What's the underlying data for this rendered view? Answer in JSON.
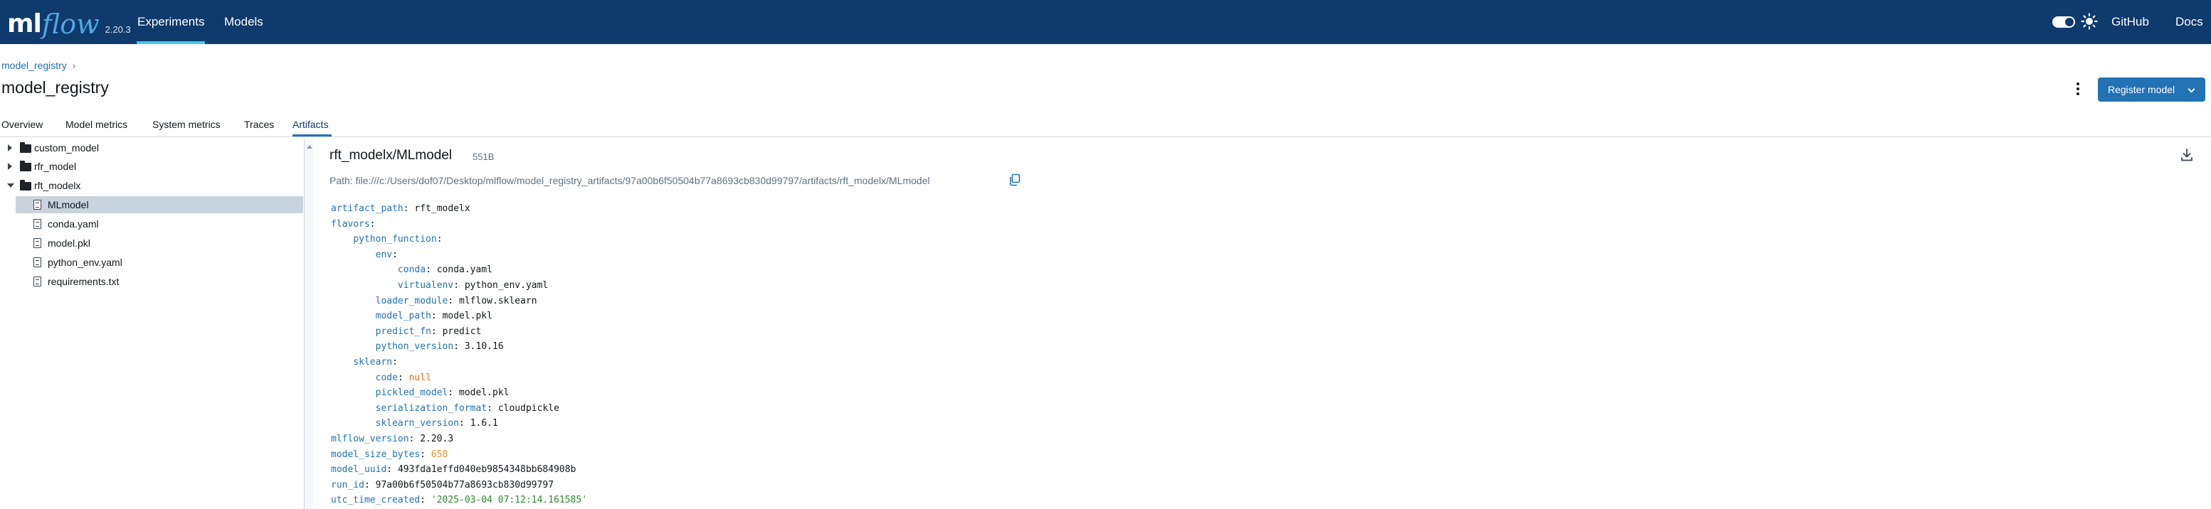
{
  "header": {
    "logo_ml": "ml",
    "logo_flow": "flow",
    "version": "2.20.3",
    "nav": [
      {
        "label": "Experiments",
        "active": true
      },
      {
        "label": "Models",
        "active": false
      }
    ],
    "github_label": "GitHub",
    "docs_label": "Docs",
    "theme_icon": "sun-icon",
    "accent_color": "#43c9ed",
    "bar_color": "#0e3a6c"
  },
  "breadcrumb": {
    "items": [
      "model_registry"
    ],
    "separator": "›"
  },
  "page": {
    "title": "model_registry",
    "register_button": "Register model"
  },
  "tabs": [
    {
      "label": "Overview",
      "active": false
    },
    {
      "label": "Model metrics",
      "active": false
    },
    {
      "label": "System metrics",
      "active": false
    },
    {
      "label": "Traces",
      "active": false
    },
    {
      "label": "Artifacts",
      "active": true
    }
  ],
  "tree": [
    {
      "label": "custom_model",
      "type": "folder",
      "expanded": false
    },
    {
      "label": "rfr_model",
      "type": "folder",
      "expanded": false
    },
    {
      "label": "rft_modelx",
      "type": "folder",
      "expanded": true
    },
    {
      "label": "MLmodel",
      "type": "file",
      "selected": true
    },
    {
      "label": "conda.yaml",
      "type": "file",
      "selected": false
    },
    {
      "label": "model.pkl",
      "type": "file",
      "selected": false
    },
    {
      "label": "python_env.yaml",
      "type": "file",
      "selected": false
    },
    {
      "label": "requirements.txt",
      "type": "file",
      "selected": false
    }
  ],
  "artifact": {
    "title": "rft_modelx/MLmodel",
    "size": "551B",
    "path": "Path: file:///c:/Users/dof07/Desktop/mlflow/model_registry_artifacts/97a00b6f50504b77a8693cb830d99797/artifacts/rft_modelx/MLmodel",
    "content": [
      {
        "indent": 0,
        "key": "artifact_path",
        "value": "rft_modelx",
        "vtype": "plain"
      },
      {
        "indent": 0,
        "key": "flavors",
        "value": "",
        "vtype": "plain"
      },
      {
        "indent": 1,
        "key": "python_function",
        "value": "",
        "vtype": "plain"
      },
      {
        "indent": 2,
        "key": "env",
        "value": "",
        "vtype": "plain"
      },
      {
        "indent": 3,
        "key": "conda",
        "value": "conda.yaml",
        "vtype": "plain"
      },
      {
        "indent": 3,
        "key": "virtualenv",
        "value": "python_env.yaml",
        "vtype": "plain"
      },
      {
        "indent": 2,
        "key": "loader_module",
        "value": "mlflow.sklearn",
        "vtype": "plain"
      },
      {
        "indent": 2,
        "key": "model_path",
        "value": "model.pkl",
        "vtype": "plain"
      },
      {
        "indent": 2,
        "key": "predict_fn",
        "value": "predict",
        "vtype": "plain"
      },
      {
        "indent": 2,
        "key": "python_version",
        "value": "3.10.16",
        "vtype": "plain"
      },
      {
        "indent": 1,
        "key": "sklearn",
        "value": "",
        "vtype": "plain"
      },
      {
        "indent": 2,
        "key": "code",
        "value": "null",
        "vtype": "null"
      },
      {
        "indent": 2,
        "key": "pickled_model",
        "value": "model.pkl",
        "vtype": "plain"
      },
      {
        "indent": 2,
        "key": "serialization_format",
        "value": "cloudpickle",
        "vtype": "plain"
      },
      {
        "indent": 2,
        "key": "sklearn_version",
        "value": "1.6.1",
        "vtype": "plain"
      },
      {
        "indent": 0,
        "key": "mlflow_version",
        "value": "2.20.3",
        "vtype": "plain"
      },
      {
        "indent": 0,
        "key": "model_size_bytes",
        "value": "658",
        "vtype": "number"
      },
      {
        "indent": 0,
        "key": "model_uuid",
        "value": "493fda1effd040eb9854348bb684908b",
        "vtype": "plain"
      },
      {
        "indent": 0,
        "key": "run_id",
        "value": "97a00b6f50504b77a8693cb830d99797",
        "vtype": "plain"
      },
      {
        "indent": 0,
        "key": "utc_time_created",
        "value": "'2025-03-04 07:12:14.161585'",
        "vtype": "string"
      }
    ]
  }
}
